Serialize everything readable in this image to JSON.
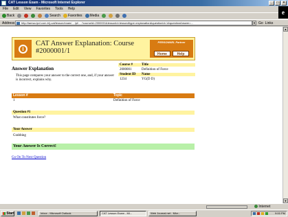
{
  "window": {
    "title": "CAT Lesson Exam - Microsoft Internet Explorer"
  },
  "menu": [
    "File",
    "Edit",
    "View",
    "Favorites",
    "Tools",
    "Help"
  ],
  "toolbar": {
    "back": "Back",
    "search": "Search",
    "favorites": "Favorites",
    "media": "Media"
  },
  "address": {
    "label": "Address",
    "url": "http://lamsa.ipvl.com.tr/j-cat/lesson/exam/... /pl/ ...?courseId=2000001&lessonId=lesson&type=explanation&questionId=1&questionAnswer=...",
    "go_label": "Go",
    "links_label": "Links"
  },
  "header": {
    "title": "CAT Answer Explanation: Course #2000001/1",
    "brand": "PERSONNEL Partner",
    "home_label": "Home",
    "help_label": "Help"
  },
  "explanation": {
    "title": "Answer Explanation",
    "description": "This page compares your answer to the correct one, and, if your answer is incorrect, explains why."
  },
  "info": {
    "course_label": "Course #",
    "course_value": "2000001",
    "title_label": "Title",
    "title_value": "Definition of Force",
    "student_label": "Student ID",
    "student_value": "1234",
    "name_label": "Name",
    "name_value": "YG(D D)"
  },
  "lesson": {
    "col1_label": "Lesson #",
    "col2_label": "Topic",
    "number": "1",
    "topic": "Definition of Force"
  },
  "question": {
    "label": "Question #1",
    "text": "What constitutes force?"
  },
  "answer": {
    "label": "Your Answer",
    "text": "Grabbing"
  },
  "result": {
    "text": "Your Answer Is Correct!"
  },
  "next_link": "Go On To Next Question",
  "status": {
    "zone": "Internet"
  },
  "taskbar": {
    "start": "Start",
    "tasks": [
      "Inbox - Microsoft Outlook",
      "CAT Lesson Exam - Mi...",
      "Web Journal.net - Micr..."
    ],
    "clock": "9:00 PM"
  }
}
